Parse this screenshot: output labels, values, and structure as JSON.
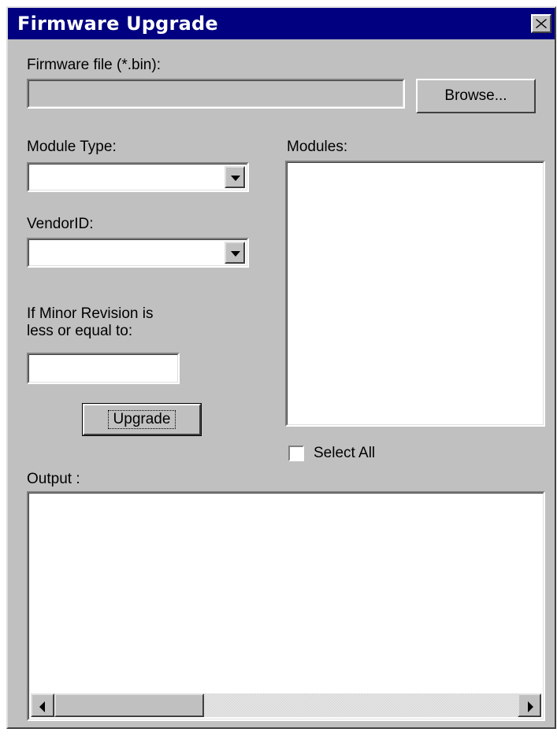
{
  "window": {
    "title": "Firmware Upgrade"
  },
  "firmware": {
    "label": "Firmware file (*.bin):",
    "value": "",
    "browse_label": "Browse..."
  },
  "module_type": {
    "label": "Module Type:",
    "selected": ""
  },
  "vendor": {
    "label": "VendorID:",
    "selected": ""
  },
  "minor_revision": {
    "label_line1": "If Minor Revision is",
    "label_line2": "less or equal to:",
    "value": ""
  },
  "upgrade_button": "Upgrade",
  "modules": {
    "label": "Modules:",
    "items": []
  },
  "select_all": {
    "label": "Select All",
    "checked": false
  },
  "output": {
    "label": "Output :",
    "text": ""
  },
  "icons": {
    "close": "close-icon",
    "dropdown": "chevron-down-icon",
    "scroll_left": "arrow-left-icon",
    "scroll_right": "arrow-right-icon"
  },
  "colors": {
    "titlebar": "#000080",
    "face": "#c0c0c0"
  }
}
